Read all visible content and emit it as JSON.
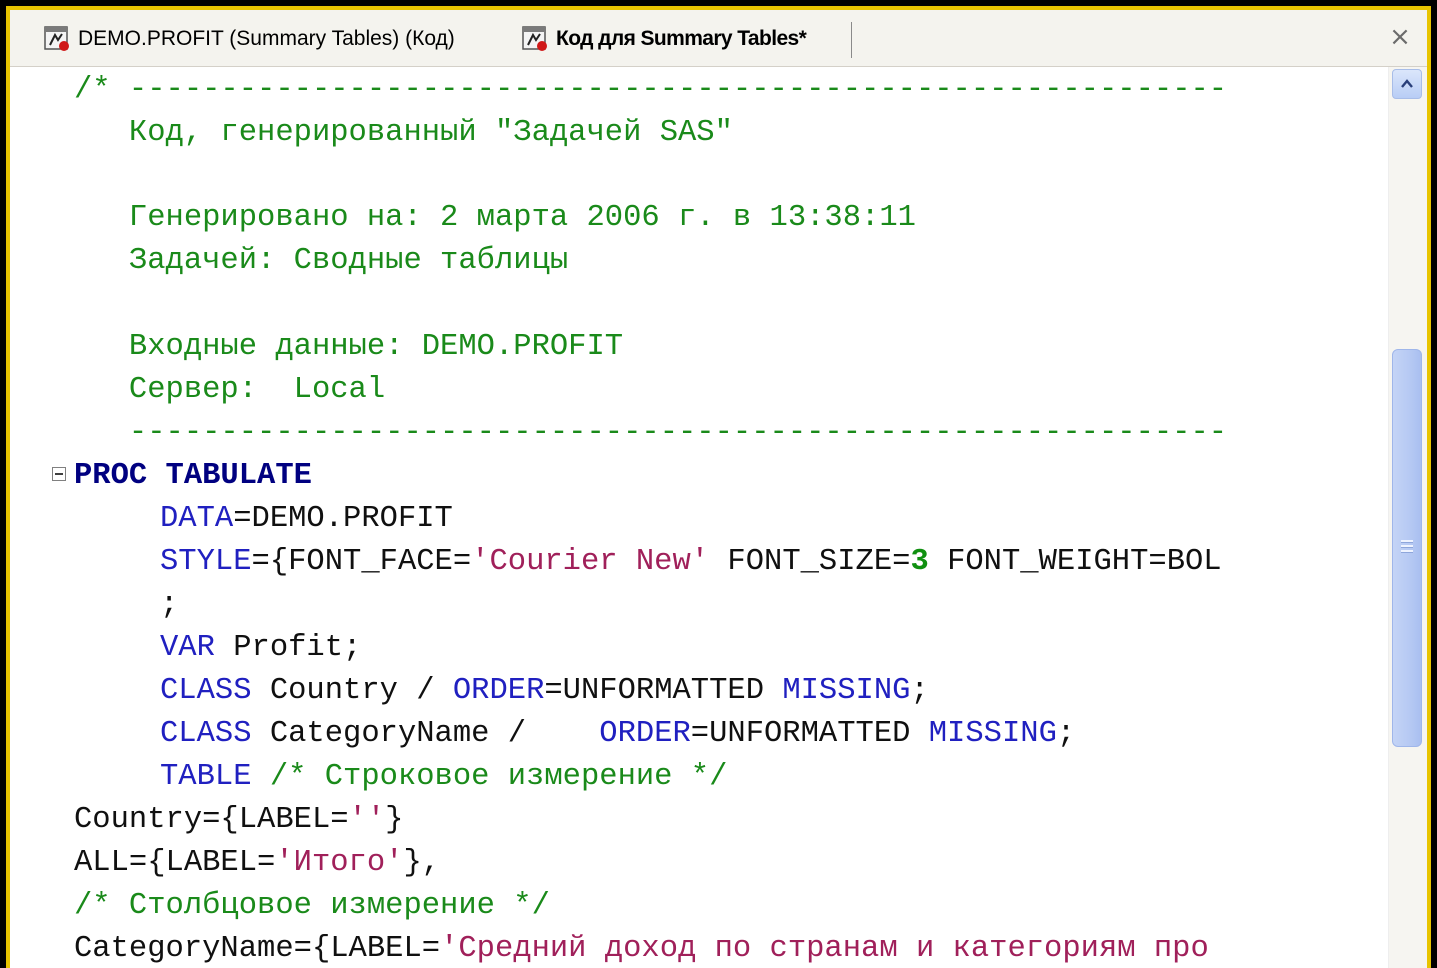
{
  "tabs": [
    {
      "label": "DEMO.PROFIT  (Summary Tables) (Код)",
      "icon": "sas-task-icon",
      "active": false
    },
    {
      "label": "Код для Summary Tables*",
      "icon": "sas-task-icon",
      "active": true
    }
  ],
  "close_glyph": "×",
  "code": {
    "l1_a": "/* ",
    "l1_b": "------------------------------------------------------------",
    "l2": "   Код, генерированный \"Задачей SAS\"",
    "l3": "   Генерировано на: 2 марта 2006 г. в 13:38:11",
    "l4": "   Задачей: Сводные таблицы",
    "l5": "   Входные данные: DEMO.PROFIT",
    "l6": "   Сервер:  Local",
    "l7": "   ------------------------------------------------------------",
    "l8_proc": "PROC TABULATE",
    "l9_kw": "DATA",
    "l9_rest": "=DEMO.PROFIT",
    "l10_kw": "STYLE",
    "l10_a": "={FONT_FACE=",
    "l10_str": "'Courier New'",
    "l10_b": " FONT_SIZE=",
    "l10_num": "3",
    "l10_c": " FONT_WEIGHT=BOL",
    "l11": ";",
    "l12_kw": "VAR",
    "l12_rest": " Profit;",
    "l13_kw": "CLASS",
    "l13_a": " Country / ",
    "l13_kw2": "ORDER",
    "l13_b": "=UNFORMATTED ",
    "l13_kw3": "MISSING",
    "l13_c": ";",
    "l14_kw": "CLASS",
    "l14_a": " CategoryName /    ",
    "l14_kw2": "ORDER",
    "l14_b": "=UNFORMATTED ",
    "l14_kw3": "MISSING",
    "l14_c": ";",
    "l15_kw": "TABLE",
    "l15_cm": " /* Строковое измерение */",
    "l16_a": "Country={LABEL=",
    "l16_str": "''",
    "l16_b": "}",
    "l17_a": "ALL={LABEL=",
    "l17_str": "'Итого'",
    "l17_b": "},",
    "l18": "/* Столбцовое измерение */",
    "l19_a": "CategoryName={LABEL=",
    "l19_str": "'Средний доход по странам и категориям про"
  },
  "colors": {
    "comment": "#1a8a1a",
    "keyword": "#2020c0",
    "proc": "#000080",
    "string": "#a0205a",
    "frame_border": "#e8c400"
  }
}
